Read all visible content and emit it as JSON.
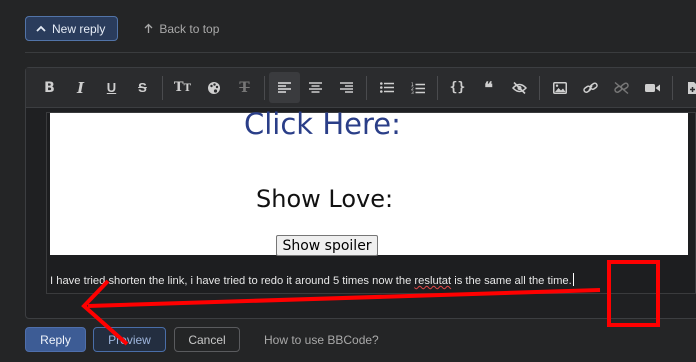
{
  "header": {
    "new_reply_label": "New reply",
    "back_to_top_label": "Back to top"
  },
  "toolbar": {
    "buttons": [
      "bold-icon",
      "italic-icon",
      "underline-icon",
      "strikethrough-icon",
      "text-size-icon",
      "text-color-icon",
      "clear-format-icon",
      "align-left-icon",
      "align-center-icon",
      "align-right-icon",
      "bullet-list-icon",
      "numbered-list-icon",
      "code-icon",
      "quote-icon",
      "spoiler-icon",
      "image-icon",
      "link-icon",
      "unlink-icon",
      "video-icon",
      "insert-icon"
    ],
    "active": "align-left-icon"
  },
  "content": {
    "link_text": "Click Here:",
    "heading_text": "Show Love:",
    "spoiler_button_label": "Show spoiler",
    "message_part1": "I have tried shorten the link, i have tried to redo it around 5 times now the ",
    "message_typo": "reslutat",
    "message_part2": " is the same all the time."
  },
  "footer": {
    "reply_label": "Reply",
    "preview_label": "Preview",
    "cancel_label": "Cancel",
    "howto_label": "How to use BBCode?"
  },
  "colors": {
    "background": "#242526",
    "accent": "#3d5c95",
    "annotation_red": "#ff0000"
  }
}
